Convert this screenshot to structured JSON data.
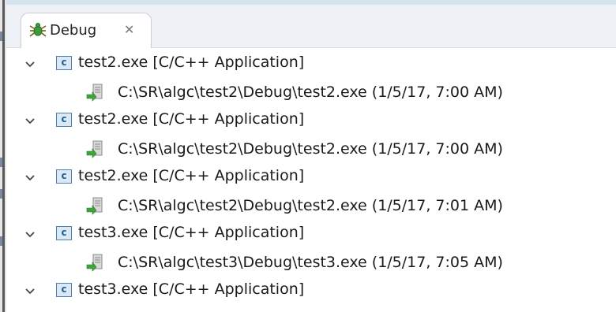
{
  "view": {
    "tab_label": "Debug",
    "tab_icon": "bug-icon",
    "close_icon": "close-icon"
  },
  "launches": [
    {
      "label": "test2.exe [C/C++ Application]",
      "expanded": true,
      "icon": "c-application-icon",
      "process": {
        "label": "C:\\SR\\algc\\test2\\Debug\\test2.exe (1/5/17, 7:00 AM)",
        "icon": "process-icon"
      }
    },
    {
      "label": "test2.exe [C/C++ Application]",
      "expanded": true,
      "icon": "c-application-icon",
      "process": {
        "label": "C:\\SR\\algc\\test2\\Debug\\test2.exe (1/5/17, 7:00 AM)",
        "icon": "process-icon"
      }
    },
    {
      "label": "test2.exe [C/C++ Application]",
      "expanded": true,
      "icon": "c-application-icon",
      "process": {
        "label": "C:\\SR\\algc\\test2\\Debug\\test2.exe (1/5/17, 7:01 AM)",
        "icon": "process-icon"
      }
    },
    {
      "label": "test3.exe [C/C++ Application]",
      "expanded": true,
      "icon": "c-application-icon",
      "process": {
        "label": "C:\\SR\\algc\\test3\\Debug\\test3.exe (1/5/17, 7:05 AM)",
        "icon": "process-icon"
      }
    },
    {
      "label": "test3.exe [C/C++ Application]",
      "expanded": true,
      "icon": "c-application-icon"
    }
  ],
  "colors": {
    "tab_background": "#ffffff",
    "tab_bar_background": "#eef1f6",
    "icon_blue": "#4a7db1",
    "process_green": "#3fa33a"
  }
}
